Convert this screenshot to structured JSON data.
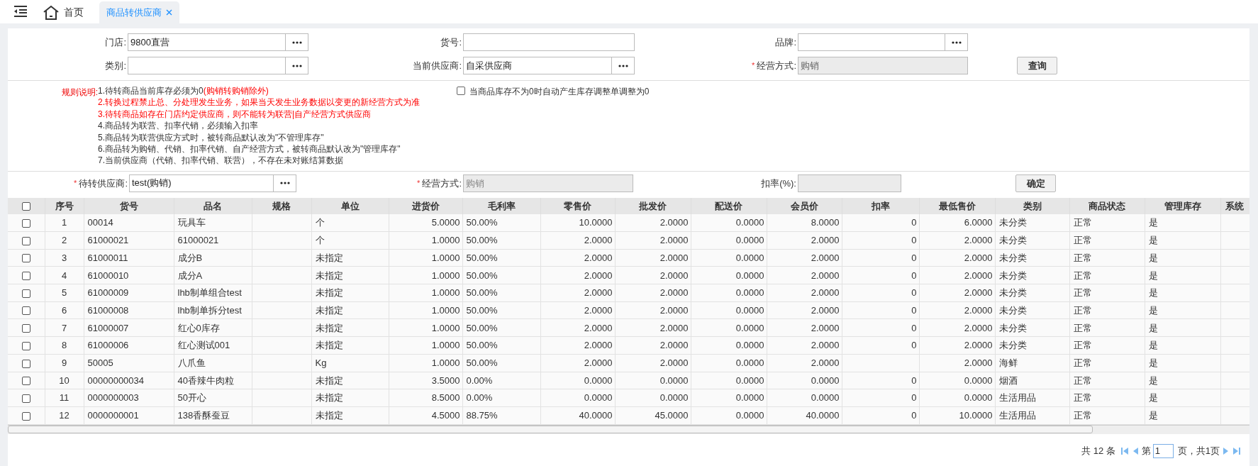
{
  "tabs": [
    {
      "label": "首页",
      "kind": "home",
      "selected": false
    },
    {
      "label": "商品转供应商",
      "kind": "page",
      "selected": true
    }
  ],
  "query_rows": [
    [
      {
        "label": "门店:",
        "value": "9800直营",
        "kind": "picker",
        "disabled": false
      },
      {
        "label": "货号:",
        "kind": "text",
        "disabled": false
      },
      {
        "label": "品牌:",
        "kind": "picker",
        "disabled": false
      }
    ],
    [
      {
        "label": "类别:",
        "kind": "picker",
        "disabled": false
      },
      {
        "label": "当前供应商:",
        "value": "自采供应商",
        "kind": "picker",
        "disabled": false
      },
      {
        "required_mark": "*",
        "label": "经营方式:",
        "value": "购销",
        "kind": "text",
        "disabled": true
      }
    ]
  ],
  "query_button": "查询",
  "rules": {
    "title": "规则说明:",
    "lines": [
      [
        {
          "text": "1.待转商品当前库存必须为0",
          "warning": false
        },
        {
          "text": "(购销转购销除外)",
          "warning": true
        }
      ],
      [
        {
          "text": "2.转换过程禁止总、分处理发生业务，如果当天发生业务数据以变更的新经营方式为准",
          "warning": true
        }
      ],
      [
        {
          "text": "3.待转商品如存在门店约定供应商，则不能转为联营|自产经营方式供应商",
          "warning": true
        }
      ],
      [
        {
          "text": "4.商品转为联营、扣率代销，必须输入扣率",
          "warning": false
        }
      ],
      [
        {
          "text": "5.商品转为联营供应方式时，被转商品默认改为\"不管理库存\"",
          "warning": false
        }
      ],
      [
        {
          "text": "6.商品转为购销、代销、扣率代销、自产经营方式，被转商品默认改为\"管理库存\"",
          "warning": false
        }
      ],
      [
        {
          "text": "7.当前供应商（代销、扣率代销、联营），不存在未对账结算数据",
          "warning": false
        }
      ]
    ]
  },
  "auto_adjust": {
    "label": "当商品库存不为0时自动产生库存调整单调整为0",
    "checked": false
  },
  "target_row": [
    {
      "required_mark": "*",
      "label": "待转供应商:",
      "value": "test(购销)",
      "kind": "picker",
      "disabled": false
    },
    {
      "required_mark": "*",
      "label": "经营方式:",
      "placeholder": "购销",
      "kind": "text",
      "disabled": true
    },
    {
      "label": "扣率(%):",
      "kind": "text",
      "disabled": true
    }
  ],
  "confirm_button": "确定",
  "table": {
    "all_checked": false,
    "columns": [
      "序号",
      "货号",
      "品名",
      "规格",
      "单位",
      "进货价",
      "毛利率",
      "零售价",
      "批发价",
      "配送价",
      "会员价",
      "扣率",
      "最低售价",
      "类别",
      "商品状态",
      "管理库存",
      "系统"
    ],
    "rows": [
      {
        "checked": false,
        "cells": [
          "1",
          "00014",
          "玩具车",
          null,
          "个",
          "5.0000",
          "50.00%",
          "10.0000",
          "2.0000",
          "0.0000",
          "8.0000",
          "0",
          "6.0000",
          "未分类",
          "正常",
          "是",
          null
        ]
      },
      {
        "checked": false,
        "cells": [
          "2",
          "61000021",
          "61000021",
          null,
          "个",
          "1.0000",
          "50.00%",
          "2.0000",
          "2.0000",
          "0.0000",
          "2.0000",
          "0",
          "2.0000",
          "未分类",
          "正常",
          "是",
          null
        ]
      },
      {
        "checked": false,
        "cells": [
          "3",
          "61000011",
          "成分B",
          null,
          "未指定",
          "1.0000",
          "50.00%",
          "2.0000",
          "2.0000",
          "0.0000",
          "2.0000",
          "0",
          "2.0000",
          "未分类",
          "正常",
          "是",
          null
        ]
      },
      {
        "checked": false,
        "cells": [
          "4",
          "61000010",
          "成分A",
          null,
          "未指定",
          "1.0000",
          "50.00%",
          "2.0000",
          "2.0000",
          "0.0000",
          "2.0000",
          "0",
          "2.0000",
          "未分类",
          "正常",
          "是",
          null
        ]
      },
      {
        "checked": false,
        "cells": [
          "5",
          "61000009",
          "lhb制单组合test",
          null,
          "未指定",
          "1.0000",
          "50.00%",
          "2.0000",
          "2.0000",
          "0.0000",
          "2.0000",
          "0",
          "2.0000",
          "未分类",
          "正常",
          "是",
          null
        ]
      },
      {
        "checked": false,
        "cells": [
          "6",
          "61000008",
          "lhb制单拆分test",
          null,
          "未指定",
          "1.0000",
          "50.00%",
          "2.0000",
          "2.0000",
          "0.0000",
          "2.0000",
          "0",
          "2.0000",
          "未分类",
          "正常",
          "是",
          null
        ]
      },
      {
        "checked": false,
        "cells": [
          "7",
          "61000007",
          "红心0库存",
          null,
          "未指定",
          "1.0000",
          "50.00%",
          "2.0000",
          "2.0000",
          "0.0000",
          "2.0000",
          "0",
          "2.0000",
          "未分类",
          "正常",
          "是",
          null
        ]
      },
      {
        "checked": false,
        "cells": [
          "8",
          "61000006",
          "红心测试001",
          null,
          "未指定",
          "1.0000",
          "50.00%",
          "2.0000",
          "2.0000",
          "0.0000",
          "2.0000",
          "0",
          "2.0000",
          "未分类",
          "正常",
          "是",
          null
        ]
      },
      {
        "checked": false,
        "cells": [
          "9",
          "50005",
          "八爪鱼",
          null,
          "Kg",
          "1.0000",
          "50.00%",
          "2.0000",
          "2.0000",
          "0.0000",
          "2.0000",
          null,
          "2.0000",
          "海鲜",
          "正常",
          "是",
          null
        ]
      },
      {
        "checked": false,
        "cells": [
          "10",
          "00000000034",
          "40香辣牛肉粒",
          null,
          "未指定",
          "3.5000",
          "0.00%",
          "0.0000",
          "0.0000",
          "0.0000",
          "0.0000",
          "0",
          "0.0000",
          "烟酒",
          "正常",
          "是",
          null
        ]
      },
      {
        "checked": false,
        "cells": [
          "11",
          "0000000003",
          "50开心",
          null,
          "未指定",
          "8.5000",
          "0.00%",
          "0.0000",
          "0.0000",
          "0.0000",
          "0.0000",
          "0",
          "0.0000",
          "生活用品",
          "正常",
          "是",
          null
        ]
      },
      {
        "checked": false,
        "cells": [
          "12",
          "0000000001",
          "138香酥蚕豆",
          null,
          "未指定",
          "4.5000",
          "88.75%",
          "40.0000",
          "45.0000",
          "0.0000",
          "40.0000",
          "0",
          "10.0000",
          "生活用品",
          "正常",
          "是",
          null
        ]
      }
    ]
  },
  "pagination": {
    "total": "共 12 条",
    "page_prefix": "第",
    "page": "1",
    "page_suffix": "页，共1页"
  }
}
